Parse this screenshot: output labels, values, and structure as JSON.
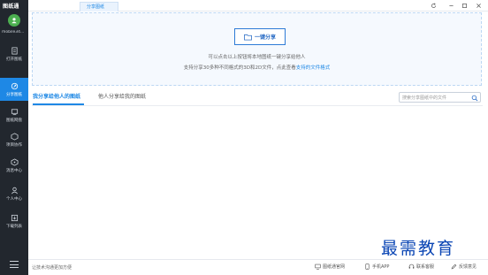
{
  "app": {
    "brand": "图纸通",
    "username": "mobile34..."
  },
  "sidebar": {
    "items": [
      {
        "label": "打开图纸",
        "icon": "open-drawing-icon"
      },
      {
        "label": "分享图纸",
        "icon": "share-drawing-icon",
        "active": true
      },
      {
        "label": "图纸网盘",
        "icon": "cloud-drive-icon"
      },
      {
        "label": "项目协作",
        "icon": "project-collab-icon"
      },
      {
        "label": "消息中心",
        "icon": "message-center-icon"
      },
      {
        "label": "个人中心",
        "icon": "personal-center-icon"
      },
      {
        "label": "下载列表",
        "icon": "download-list-icon"
      }
    ]
  },
  "topbar": {
    "tab_label": "分享图纸"
  },
  "share": {
    "button_label": "一键分享",
    "line1": "可以点击以上按钮将本地图纸一键分享给他人",
    "line2_prefix": "支持分享30多种不同格式的3D和2D文件，点此查看",
    "line2_link": "支持的文件格式"
  },
  "tabs": [
    {
      "label": "我分享给他人的图纸",
      "active": true
    },
    {
      "label": "他人分享给我的图纸",
      "active": false
    }
  ],
  "search": {
    "placeholder": "搜索分享图纸中的文件",
    "value": ""
  },
  "bottombar": {
    "left_text": "让技术沟通更加方便",
    "items": [
      {
        "label": "图纸通官网",
        "icon": "monitor-icon"
      },
      {
        "label": "手机APP",
        "icon": "phone-icon"
      },
      {
        "label": "联系客服",
        "icon": "headset-icon"
      },
      {
        "label": "反馈意见",
        "icon": "feedback-icon"
      }
    ]
  },
  "watermark": "最需教育",
  "colors": {
    "accent": "#1e88e5",
    "sidebar_bg": "#22272e",
    "avatar": "#4caf50"
  }
}
